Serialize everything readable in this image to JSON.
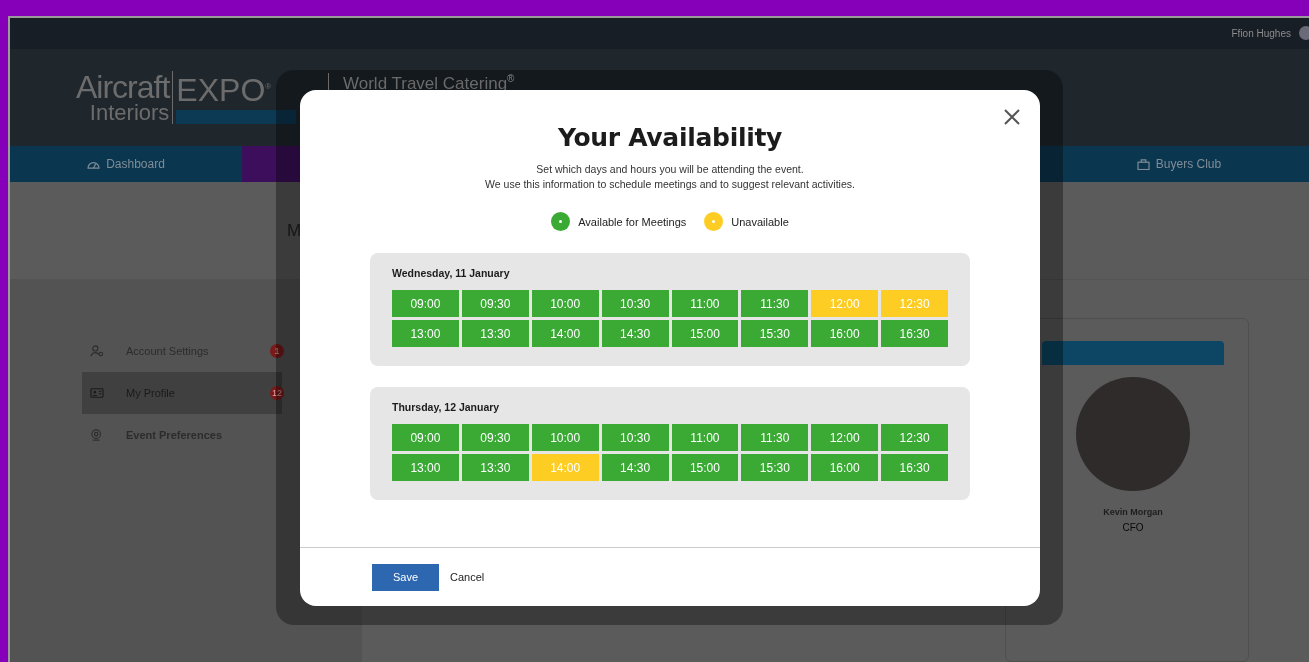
{
  "top_bar": {
    "user_name": "Ffion Hughes"
  },
  "logo": {
    "word_1": "Aircraft",
    "word_2": "Interiors",
    "word_3": "EXPO",
    "mark": "®"
  },
  "partner_logo": {
    "text": "World Travel Catering",
    "mark": "®"
  },
  "nav": [
    {
      "label": "Dashboard",
      "selected": false
    },
    {
      "selected": true
    },
    {
      "label": "Buyers Club",
      "selected": false
    }
  ],
  "page_heading": "M",
  "sidebar": {
    "items": [
      {
        "label": "Account Settings",
        "badge": "1",
        "selected": false
      },
      {
        "label": "My Profile",
        "badge": "12",
        "selected": true
      },
      {
        "label": "Event Preferences",
        "selected": false
      }
    ]
  },
  "profile_card": {
    "name": "Kevin Morgan",
    "role": "CFO"
  },
  "modal": {
    "title": "Your Availability",
    "subtitle": [
      "Set which days and hours you will be attending the event.",
      "We use this information to schedule meetings and to suggest relevant activities."
    ],
    "legend": [
      {
        "label": "Available for Meetings",
        "color": "#3aaa35"
      },
      {
        "label": "Unavailable",
        "color": "#fecd23"
      }
    ],
    "days": [
      {
        "title": "Wednesday, 11 January",
        "slots": [
          {
            "time": "09:00",
            "available": true
          },
          {
            "time": "09:30",
            "available": true
          },
          {
            "time": "10:00",
            "available": true
          },
          {
            "time": "10:30",
            "available": true
          },
          {
            "time": "11:00",
            "available": true
          },
          {
            "time": "11:30",
            "available": true
          },
          {
            "time": "12:00",
            "available": false
          },
          {
            "time": "12:30",
            "available": false
          },
          {
            "time": "13:00",
            "available": true
          },
          {
            "time": "13:30",
            "available": true
          },
          {
            "time": "14:00",
            "available": true
          },
          {
            "time": "14:30",
            "available": true
          },
          {
            "time": "15:00",
            "available": true
          },
          {
            "time": "15:30",
            "available": true
          },
          {
            "time": "16:00",
            "available": true
          },
          {
            "time": "16:30",
            "available": true
          }
        ]
      },
      {
        "title": "Thursday, 12 January",
        "slots": [
          {
            "time": "09:00",
            "available": true
          },
          {
            "time": "09:30",
            "available": true
          },
          {
            "time": "10:00",
            "available": true
          },
          {
            "time": "10:30",
            "available": true
          },
          {
            "time": "11:00",
            "available": true
          },
          {
            "time": "11:30",
            "available": true
          },
          {
            "time": "12:00",
            "available": true
          },
          {
            "time": "12:30",
            "available": true
          },
          {
            "time": "13:00",
            "available": true
          },
          {
            "time": "13:30",
            "available": true
          },
          {
            "time": "14:00",
            "available": false
          },
          {
            "time": "14:30",
            "available": true
          },
          {
            "time": "15:00",
            "available": true
          },
          {
            "time": "15:30",
            "available": true
          },
          {
            "time": "16:00",
            "available": true
          },
          {
            "time": "16:30",
            "available": true
          }
        ]
      }
    ],
    "buttons": [
      {
        "label": "Save",
        "kind": "primary"
      },
      {
        "label": "Cancel",
        "kind": "link"
      }
    ]
  }
}
